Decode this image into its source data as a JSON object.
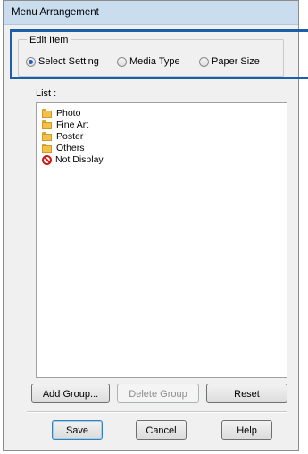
{
  "window": {
    "title": "Menu Arrangement"
  },
  "edit_item": {
    "legend": "Edit Item",
    "options": [
      {
        "label": "Select Setting",
        "selected": true
      },
      {
        "label": "Media Type",
        "selected": false
      },
      {
        "label": "Paper Size",
        "selected": false
      }
    ],
    "highlight_color": "#1a5fa8"
  },
  "list": {
    "label": "List :",
    "items": [
      {
        "label": "Photo",
        "icon": "folder-icon"
      },
      {
        "label": "Fine Art",
        "icon": "folder-icon"
      },
      {
        "label": "Poster",
        "icon": "folder-icon"
      },
      {
        "label": "Others",
        "icon": "folder-icon"
      },
      {
        "label": "Not Display",
        "icon": "not-display-icon"
      }
    ]
  },
  "list_buttons": {
    "add_group": "Add Group...",
    "delete_group": "Delete Group",
    "reset": "Reset"
  },
  "footer_buttons": {
    "save": "Save",
    "cancel": "Cancel",
    "help": "Help"
  }
}
